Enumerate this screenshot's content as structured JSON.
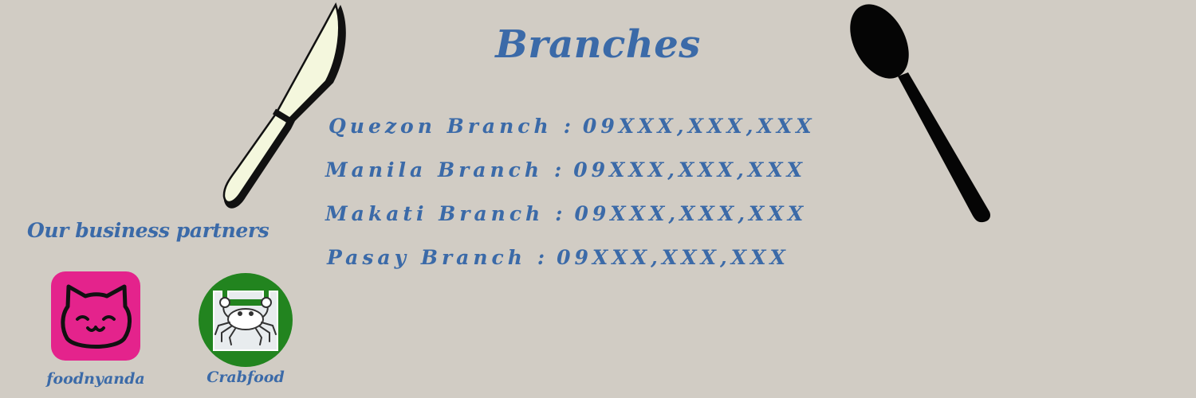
{
  "heading": {
    "title": "Branches"
  },
  "branches": [
    {
      "name": "Quezon Branch",
      "separator": ":",
      "phone": "09XXX,XXX,XXX"
    },
    {
      "name": "Manila Branch",
      "separator": ":",
      "phone": "09XXX,XXX,XXX"
    },
    {
      "name": "Makati Branch",
      "separator": ":",
      "phone": "09XXX,XXX,XXX"
    },
    {
      "name": "Pasay Branch",
      "separator": ":",
      "phone": "09XXX,XXX,XXX"
    }
  ],
  "partners": {
    "title": "Our business partners",
    "items": [
      {
        "name": "foodnyanda",
        "icon": "cat-logo-icon",
        "color": "#e4238c"
      },
      {
        "name": "Crabfood",
        "icon": "crab-logo-icon",
        "color": "#22841f"
      }
    ]
  },
  "decorations": {
    "knife_icon": "knife-icon",
    "spoon_icon": "spoon-icon"
  },
  "colors": {
    "background": "#d1ccc4",
    "text": "#3b6aa8",
    "knife_blade": "#f4f7dd",
    "spoon": "#050505"
  }
}
